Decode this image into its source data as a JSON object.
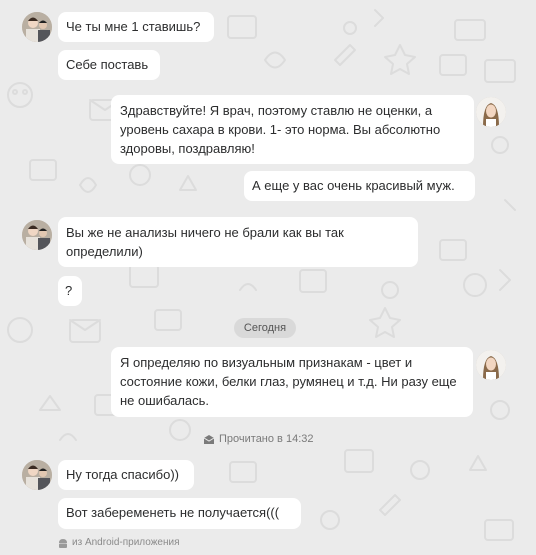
{
  "messages": {
    "m1": "Че ты мне 1 ставишь?",
    "m2": "Себе поставь",
    "m3": "Здравствуйте! Я врач, поэтому ставлю не оценки, а уровень сахара в крови. 1- это норма. Вы абсолютно здоровы, поздравляю!",
    "m4": "А еще у вас очень красивый муж.",
    "m5": "Вы же не анализы ничего не брали как вы так определили)",
    "m6": "?",
    "m7": "Я определяю по визуальным признакам - цвет и состояние кожи, белки глаз, румянец и т.д. Ни разу еще не ошибалась.",
    "m8": "Ну тогда спасибо))",
    "m9": "Вот забеременеть не получается((("
  },
  "date_divider": "Сегодня",
  "read_status": "Прочитано в 14:32",
  "client_note": "из Android-приложения",
  "icons": {
    "read": "envelope-open-icon",
    "android": "android-icon"
  },
  "colors": {
    "background": "#ebebeb",
    "bubble": "#ffffff",
    "text": "#2c2d2e",
    "doodle": "#dcdcdc"
  }
}
